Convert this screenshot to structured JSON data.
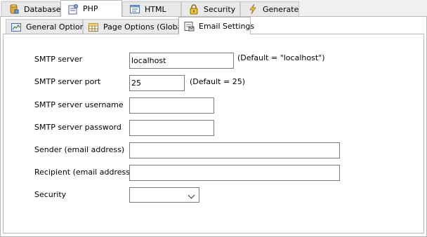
{
  "top_tabs": [
    {
      "label": "Database",
      "icon": "database-icon"
    },
    {
      "label": "PHP",
      "icon": "php-icon",
      "active": true
    },
    {
      "label": "HTML",
      "icon": "html-icon"
    },
    {
      "label": "Security",
      "icon": "lock-icon"
    },
    {
      "label": "Generate",
      "icon": "lightning-icon"
    }
  ],
  "sub_tabs": [
    {
      "label": "General Options",
      "icon": "options-icon"
    },
    {
      "label": "Page Options (Global)",
      "icon": "page-options-icon"
    },
    {
      "label": "Email Settings",
      "icon": "email-settings-icon",
      "active": true
    }
  ],
  "form": {
    "smtp_server": {
      "label": "SMTP server",
      "value": "localhost",
      "hint": "(Default = \"localhost\")"
    },
    "smtp_port": {
      "label": "SMTP server port",
      "value": "25",
      "hint": "(Default = 25)"
    },
    "smtp_username": {
      "label": "SMTP server username",
      "value": ""
    },
    "smtp_password": {
      "label": "SMTP server password",
      "value": ""
    },
    "sender": {
      "label": "Sender (email address)",
      "value": ""
    },
    "recipient": {
      "label": "Recipient (email address)",
      "value": ""
    },
    "security": {
      "label": "Security",
      "value": ""
    }
  }
}
